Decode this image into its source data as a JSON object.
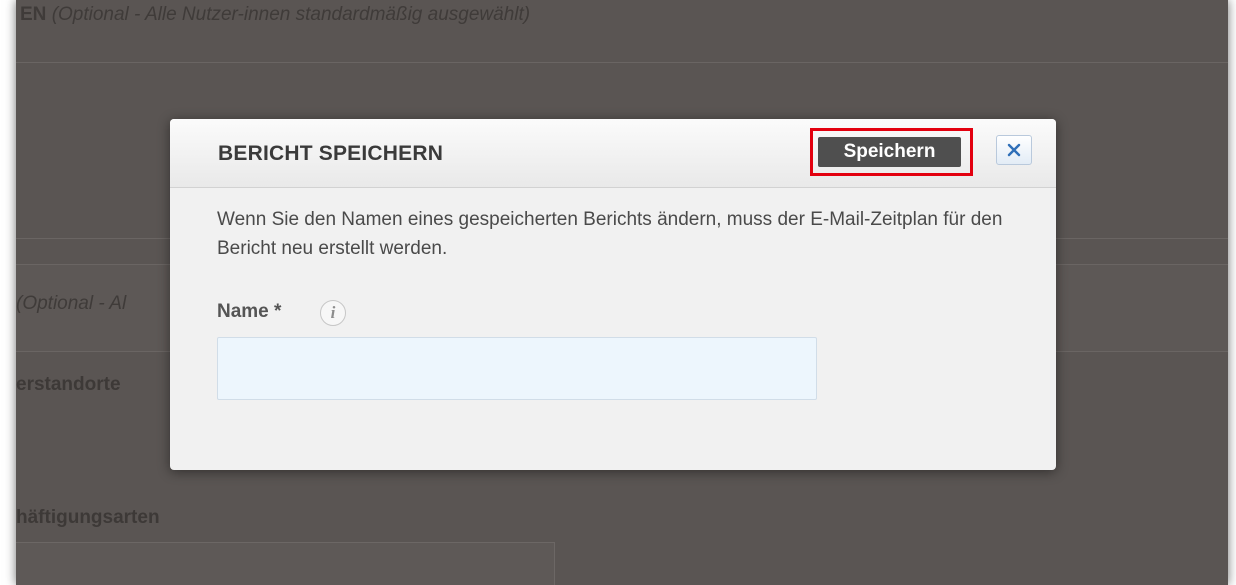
{
  "background": {
    "section_title_bold": "EN",
    "section_title_note": "(Optional - Alle Nutzer-innen standardmäßig ausgewählt)",
    "optional_fragment": "(Optional - Al",
    "label_locations": "erstandorte",
    "label_employment_types": "häftigungsarten"
  },
  "dialog": {
    "title": "BERICHT SPEICHERN",
    "save_label": "Speichern",
    "message": "Wenn Sie den Namen eines gespeicherten Berichts ändern, muss der E-Mail-Zeitplan für den Bericht neu erstellt werden.",
    "name_label": "Name *",
    "name_value": "",
    "info_icon": "info-icon",
    "close_icon": "close-icon"
  },
  "colors": {
    "overlay": "#5a5553",
    "save_button": "#4f4f4f",
    "highlight": "#e3000f",
    "input_background": "#edf6fd"
  }
}
